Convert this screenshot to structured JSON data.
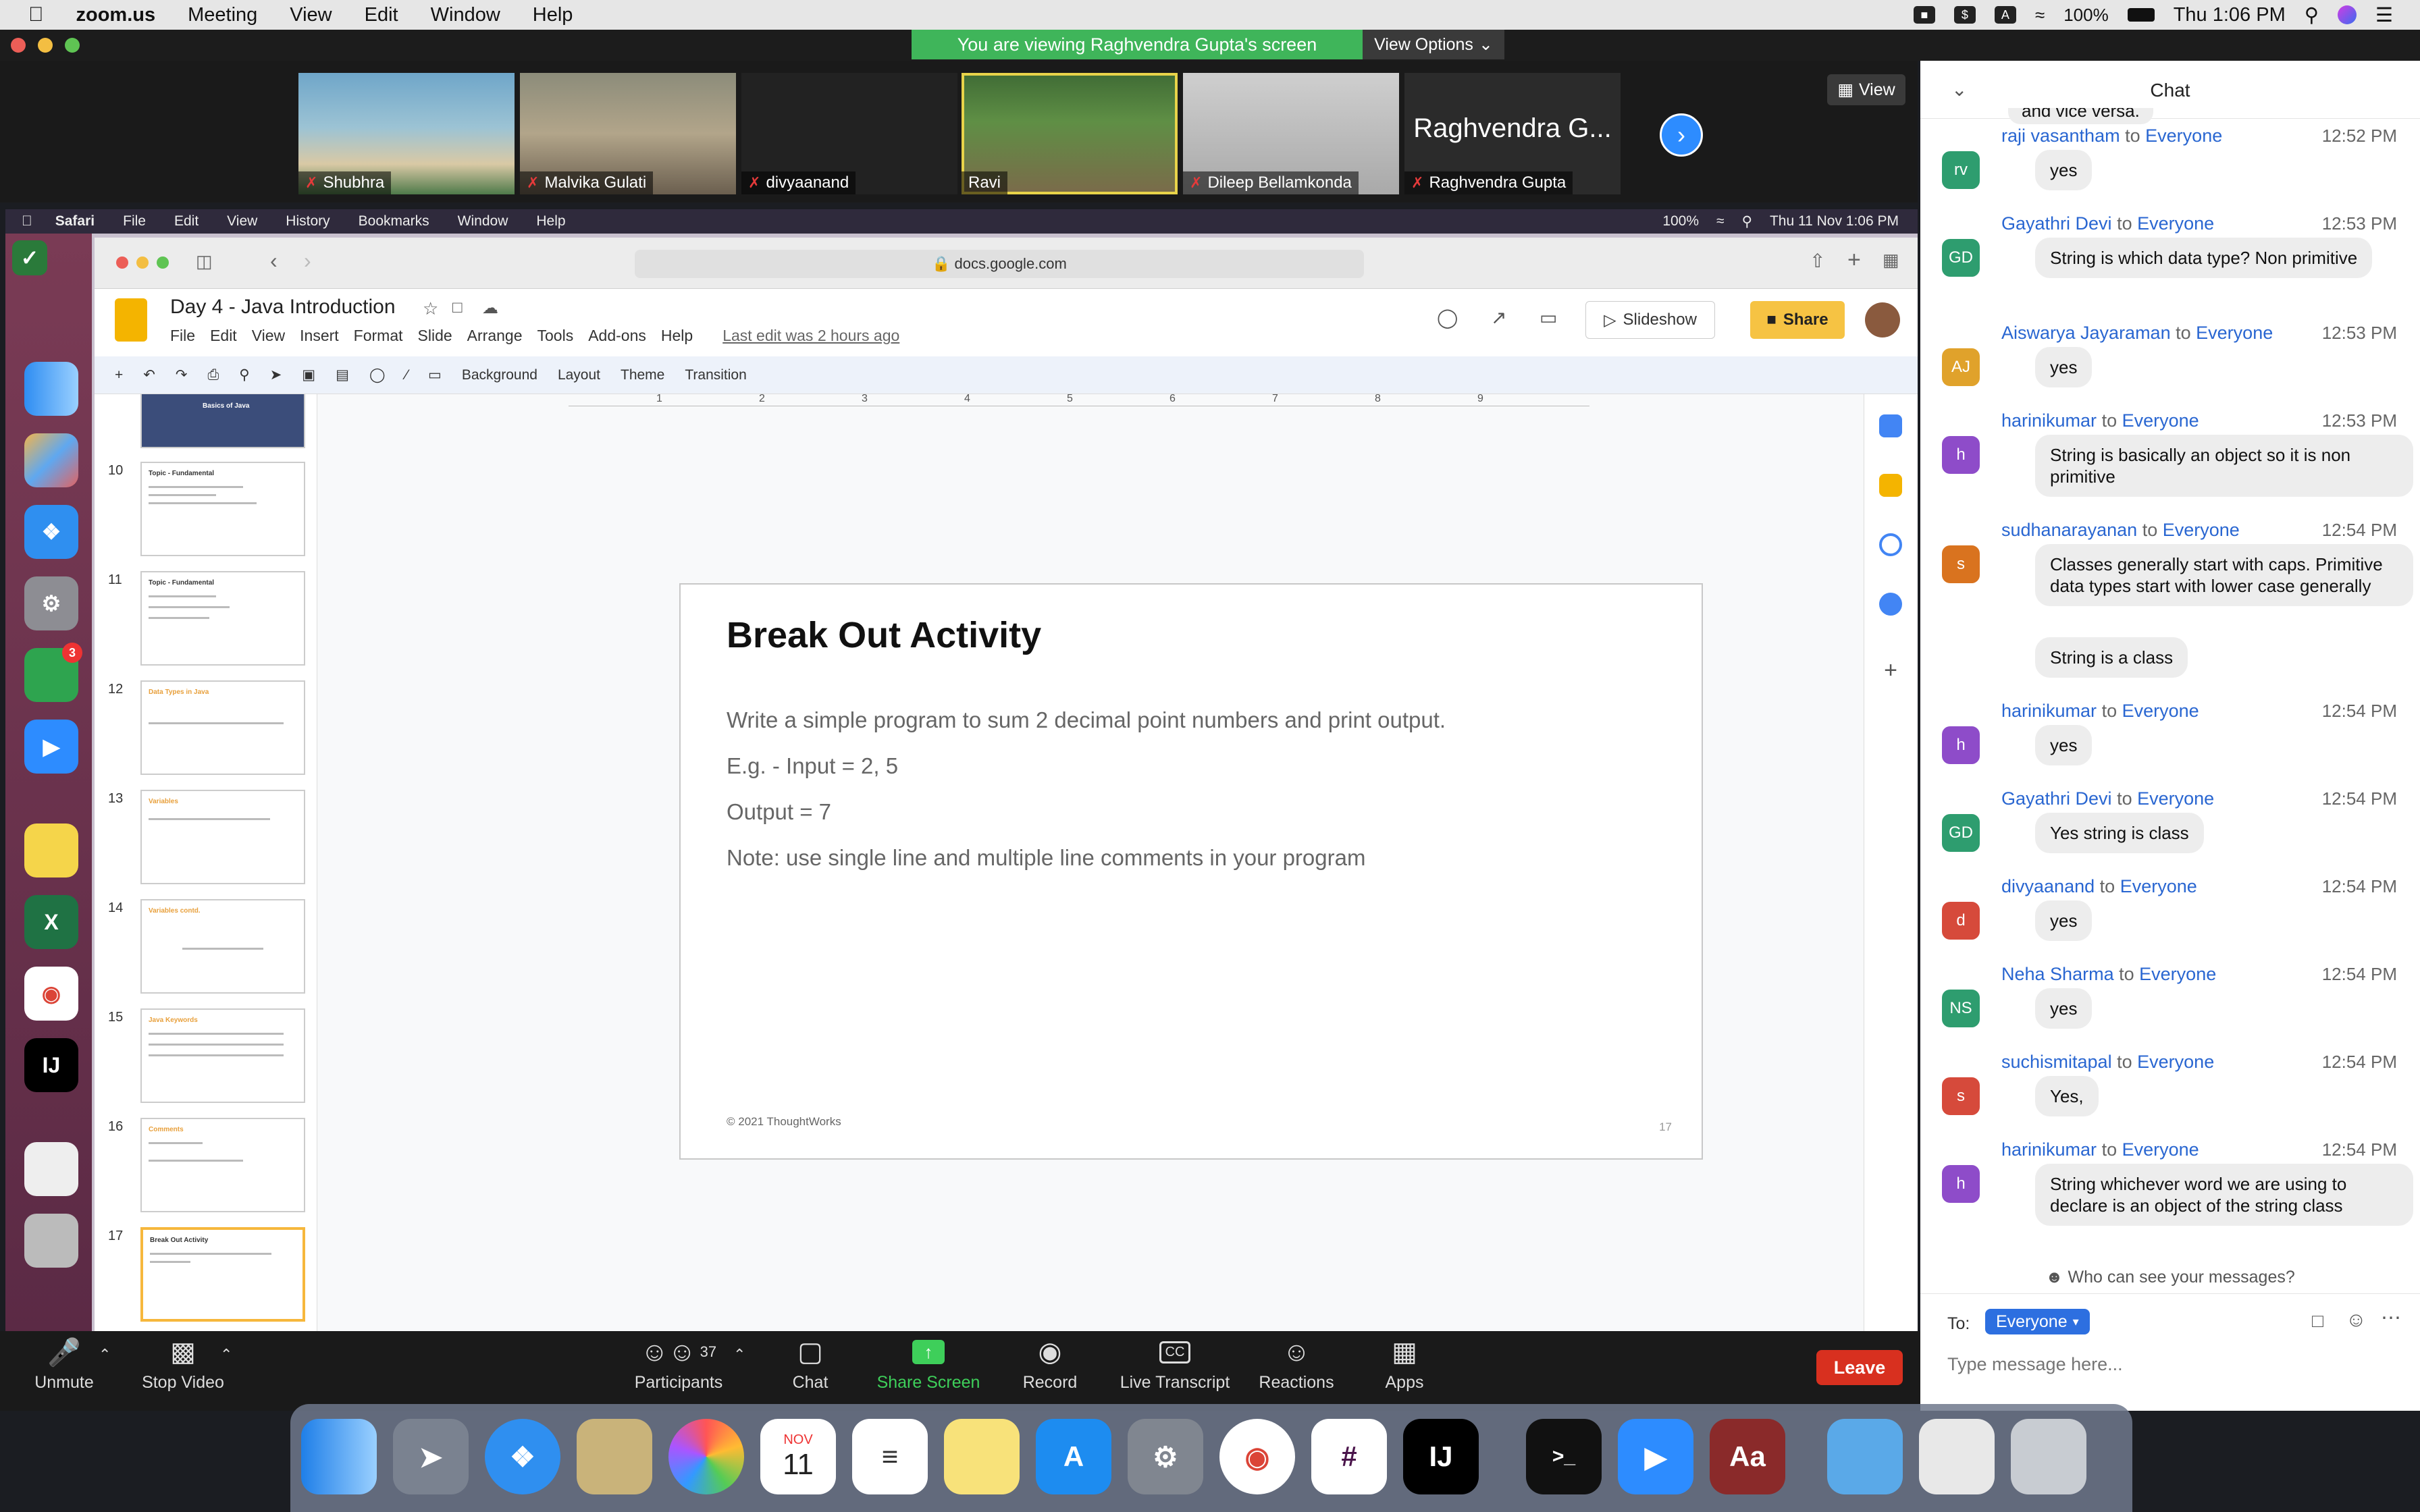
{
  "host_menubar": {
    "app": "zoom.us",
    "items": [
      "Meeting",
      "View",
      "Edit",
      "Window",
      "Help"
    ],
    "battery": "100%",
    "clock": "Thu 1:06 PM"
  },
  "banner": {
    "viewing_text": "You are viewing Raghvendra Gupta's screen",
    "view_options": "View Options"
  },
  "video_strip": {
    "view_label": "View",
    "tiles": [
      {
        "name": "Shubhra",
        "muted": true
      },
      {
        "name": "Malvika Gulati",
        "muted": true
      },
      {
        "name": "divyaanand",
        "muted": true
      },
      {
        "name": "Ravi",
        "muted": false
      },
      {
        "name": "Dileep Bellamkonda",
        "muted": true
      },
      {
        "name": "Raghvendra Gupta",
        "muted": true,
        "big_label": "Raghvendra G..."
      }
    ]
  },
  "inner_menubar": {
    "app": "Safari",
    "items": [
      "File",
      "Edit",
      "View",
      "History",
      "Bookmarks",
      "Window",
      "Help"
    ],
    "battery": "100%",
    "clock": "Thu 11 Nov  1:06 PM"
  },
  "safari": {
    "url": "docs.google.com"
  },
  "slides": {
    "doc_title": "Day 4 - Java Introduction",
    "menus": [
      "File",
      "Edit",
      "View",
      "Insert",
      "Format",
      "Slide",
      "Arrange",
      "Tools",
      "Add-ons",
      "Help"
    ],
    "last_edit": "Last edit was 2 hours ago",
    "slideshow_label": "Slideshow",
    "share_label": "Share",
    "toolbar": {
      "background": "Background",
      "layout": "Layout",
      "theme": "Theme",
      "transition": "Transition"
    },
    "ruler_ticks": [
      "1",
      "2",
      "3",
      "4",
      "5",
      "6",
      "7",
      "8",
      "9"
    ],
    "thumbnails": [
      {
        "num": "",
        "title": "Basics of Java"
      },
      {
        "num": "10",
        "title": "Topic - Fundamental"
      },
      {
        "num": "11",
        "title": "Topic - Fundamental"
      },
      {
        "num": "12",
        "title": "Data Types in Java"
      },
      {
        "num": "13",
        "title": "Variables"
      },
      {
        "num": "14",
        "title": "Variables contd."
      },
      {
        "num": "15",
        "title": "Java Keywords"
      },
      {
        "num": "16",
        "title": "Comments"
      },
      {
        "num": "17",
        "title": "Break Out Activity"
      }
    ],
    "current_slide": {
      "title": "Break Out Activity",
      "lines": [
        "Write a simple program to sum 2 decimal point numbers and print output.",
        "E.g. - Input = 2, 5",
        "Output = 7",
        "Note: use single line and multiple line comments in your program"
      ],
      "footer": "© 2021 ThoughtWorks",
      "page_num": "17"
    }
  },
  "chat": {
    "title": "Chat",
    "partial_top": "and vice versa.",
    "messages": [
      {
        "sender": "raji vasantham",
        "to": "to",
        "target": "Everyone",
        "time": "12:52 PM",
        "initials": "rv",
        "color": "#2e9d6f",
        "bubbles": [
          "yes"
        ]
      },
      {
        "sender": "Gayathri Devi",
        "to": "to",
        "target": "Everyone",
        "time": "12:53 PM",
        "initials": "GD",
        "color": "#2e9d6f",
        "bubbles": [
          "String is which data type? Non primitive"
        ]
      },
      {
        "sender": "Aiswarya Jayaraman",
        "to": "to",
        "target": "Everyone",
        "time": "12:53 PM",
        "initials": "AJ",
        "color": "#e0a22b",
        "bubbles": [
          "yes"
        ]
      },
      {
        "sender": "harinikumar",
        "to": "to",
        "target": "Everyone",
        "time": "12:53 PM",
        "initials": "h",
        "color": "#8e4cc9",
        "bubbles": [
          "String is basically an object so it is non primitive"
        ]
      },
      {
        "sender": "sudhanarayanan",
        "to": "to",
        "target": "Everyone",
        "time": "12:54 PM",
        "initials": "s",
        "color": "#d9731f",
        "bubbles": [
          "Classes generally start with caps. Primitive data types start with lower case generally",
          "String is a class"
        ]
      },
      {
        "sender": "harinikumar",
        "to": "to",
        "target": "Everyone",
        "time": "12:54 PM",
        "initials": "h",
        "color": "#8e4cc9",
        "bubbles": [
          "yes"
        ]
      },
      {
        "sender": "Gayathri Devi",
        "to": "to",
        "target": "Everyone",
        "time": "12:54 PM",
        "initials": "GD",
        "color": "#2e9d6f",
        "bubbles": [
          "Yes string is class"
        ]
      },
      {
        "sender": "divyaanand",
        "to": "to",
        "target": "Everyone",
        "time": "12:54 PM",
        "initials": "d",
        "color": "#d64a3b",
        "bubbles": [
          "yes"
        ]
      },
      {
        "sender": "Neha Sharma",
        "to": "to",
        "target": "Everyone",
        "time": "12:54 PM",
        "initials": "NS",
        "color": "#2e9d6f",
        "bubbles": [
          "yes"
        ]
      },
      {
        "sender": "suchismitapal",
        "to": "to",
        "target": "Everyone",
        "time": "12:54 PM",
        "initials": "s",
        "color": "#d64a3b",
        "bubbles": [
          "Yes,"
        ]
      },
      {
        "sender": "harinikumar",
        "to": "to",
        "target": "Everyone",
        "time": "12:54 PM",
        "initials": "h",
        "color": "#8e4cc9",
        "bubbles": [
          "String whichever word we are using to declare is an object of the string class"
        ]
      }
    ],
    "who_can_see": "Who can see your messages?",
    "to_label": "To:",
    "to_value": "Everyone",
    "input_placeholder": "Type message here..."
  },
  "zoom_toolbar": {
    "unmute": "Unmute",
    "stop_video": "Stop Video",
    "participants": "Participants",
    "participant_count": "37",
    "chat": "Chat",
    "share_screen": "Share Screen",
    "record": "Record",
    "live_transcript": "Live Transcript",
    "reactions": "Reactions",
    "apps": "Apps",
    "leave": "Leave"
  },
  "inner_dock_badge": "3",
  "host_dock": {
    "calendar_month": "NOV",
    "calendar_day": "11"
  }
}
